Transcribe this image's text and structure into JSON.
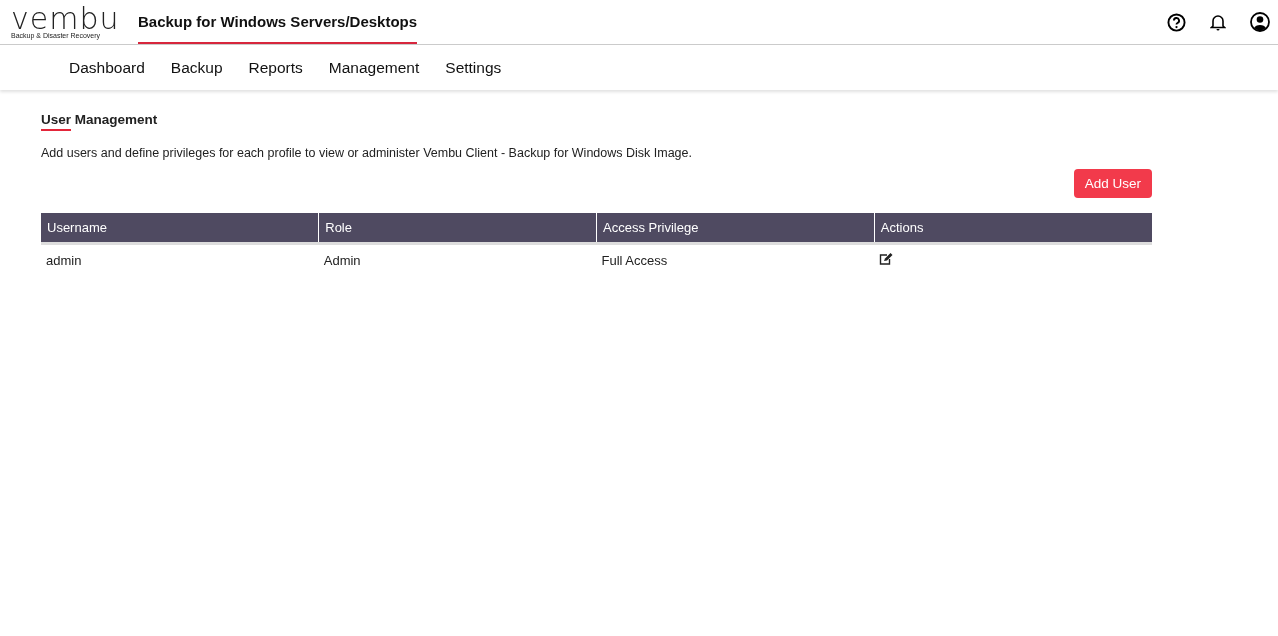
{
  "logo": {
    "wordmark": "vembu",
    "tagline": "Backup & Disaster Recovery"
  },
  "product_tabs": [
    {
      "label": "Backup for Windows Servers/Desktops",
      "selected": true
    }
  ],
  "nav": [
    "Dashboard",
    "Backup",
    "Reports",
    "Management",
    "Settings"
  ],
  "page": {
    "title": "User Management",
    "description": "Add users and define privileges for each profile to view or administer Vembu Client - Backup for Windows Disk Image.",
    "add_button": "Add User"
  },
  "table": {
    "columns": [
      "Username",
      "Role",
      "Access Privilege",
      "Actions"
    ],
    "rows": [
      {
        "username": "admin",
        "role": "Admin",
        "access": "Full Access"
      }
    ]
  }
}
